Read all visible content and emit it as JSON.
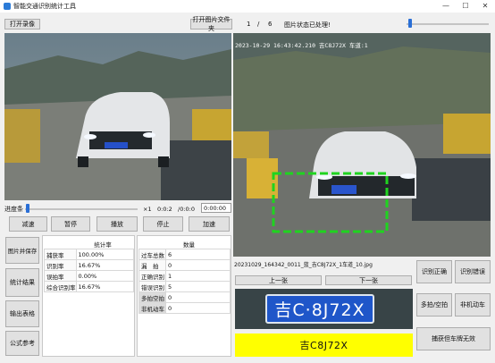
{
  "window": {
    "title": "智能交通识别统计工具",
    "minimize": "—",
    "maximize": "☐",
    "close": "✕"
  },
  "top": {
    "open_video": "打开录像",
    "open_folder": "打开图片文件夹",
    "page_current": "1",
    "page_sep": "/",
    "page_total": "6",
    "image_status_label": "图片状态:",
    "image_status_value": "已处理!",
    "zoom_progress": 0.02
  },
  "video": {
    "progress_label": "进度条",
    "speed": "×1",
    "time_current": "0:0:2",
    "time_total": "/0:0:0",
    "time_input": "0:00:00",
    "progress": 0.01
  },
  "controls": {
    "slow": "减速",
    "pause": "暂停",
    "play": "播放",
    "stop": "停止",
    "speed_up": "加速"
  },
  "left_buttons": {
    "save_screenshot": "图片并保存",
    "stats_result": "统计结果",
    "export_table": "输出表格",
    "formula_ref": "公式参考"
  },
  "stats": {
    "header": "统计率",
    "rows": [
      {
        "label": "捕获率",
        "value": "100.00%"
      },
      {
        "label": "识别率",
        "value": "16.67%"
      },
      {
        "label": "误拍率",
        "value": "0.00%"
      },
      {
        "label": "综合识别率",
        "value": "16.67%"
      }
    ]
  },
  "counts": {
    "header": "数量",
    "rows": [
      {
        "label": "过车总数",
        "value": "6"
      },
      {
        "label": "漏　拍",
        "value": "0"
      },
      {
        "label": "正确识别",
        "value": "1"
      },
      {
        "label": "错误识别",
        "value": "5"
      },
      {
        "label": "多拍空拍",
        "value": "0"
      },
      {
        "label": "非机动车",
        "value": "0"
      }
    ]
  },
  "right": {
    "overlay_text": "2023-10-29 16:43:42.210 吉C8J72X 车道:1",
    "filename": "20231029_164342_0011_蓝_吉C8J72X_1车道_10.jpg",
    "prev": "上一张",
    "next": "下一张",
    "plate_text": "吉C8J72X",
    "plate_chars": "吉C·8J72X"
  },
  "right_buttons": {
    "correct": "识别正确",
    "wrong": "识别错误",
    "multi_empty": "多拍/空拍",
    "non_motor": "非机动车",
    "capture_invalid": "捕获但车牌无效"
  }
}
